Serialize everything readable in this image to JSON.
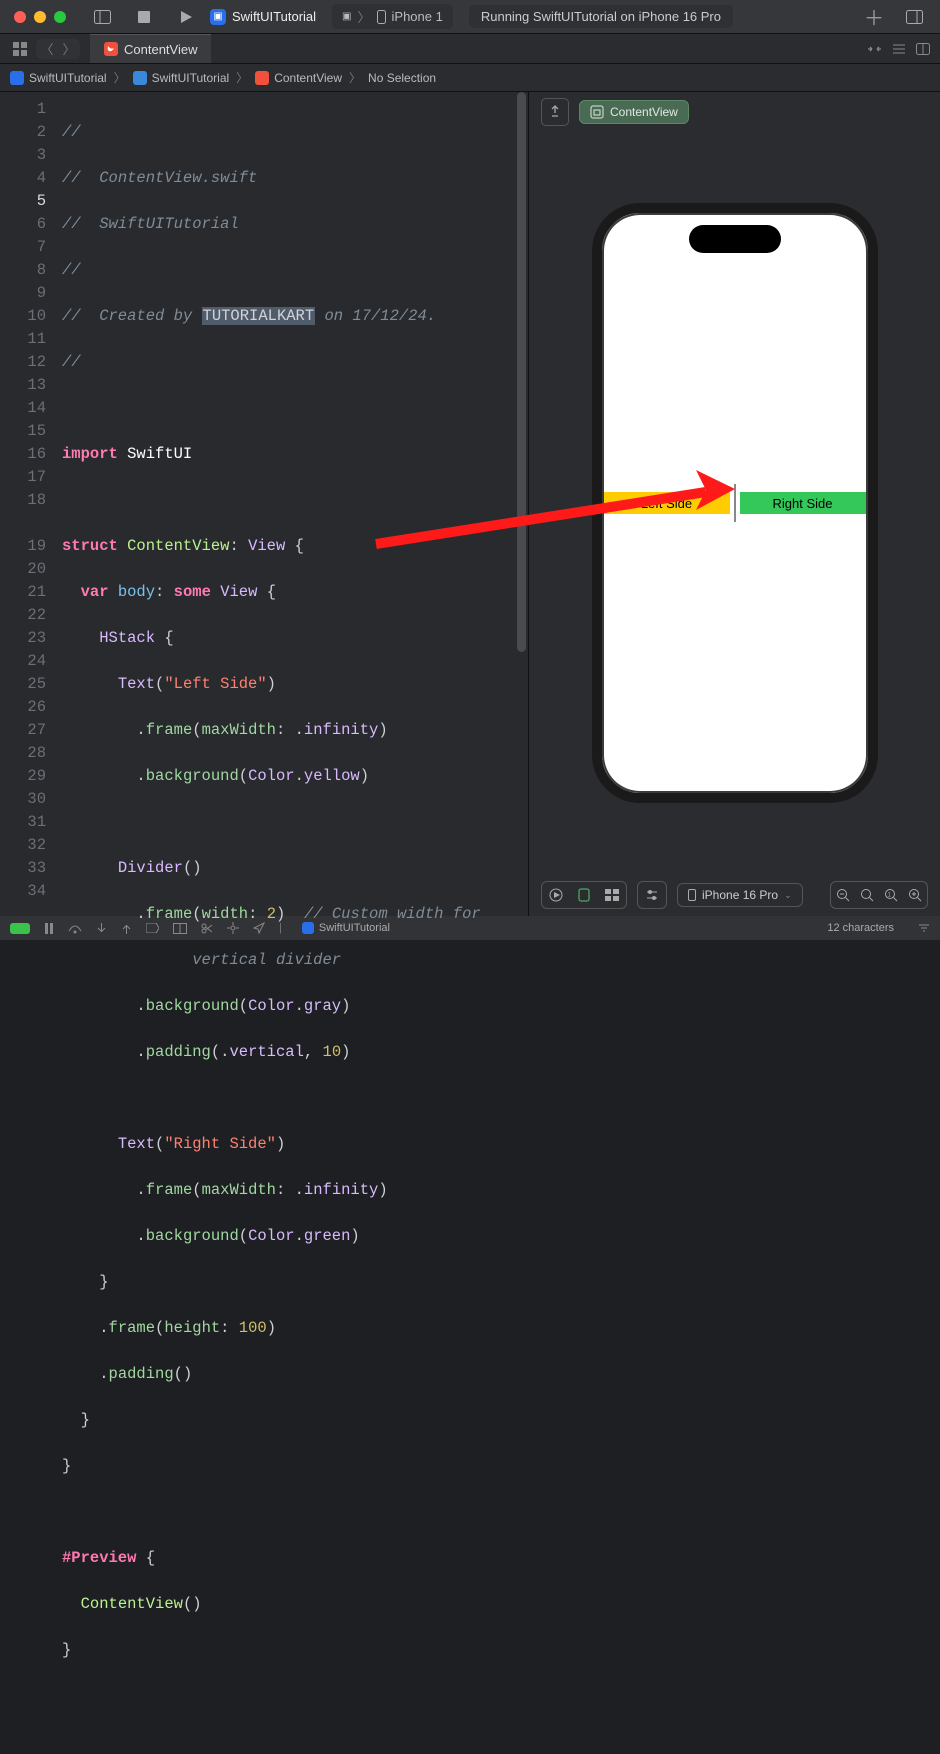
{
  "titlebar": {
    "project": "SwiftUITutorial",
    "device": "iPhone 1",
    "status": "Running SwiftUITutorial on iPhone 16 Pro"
  },
  "tab": {
    "title": "ContentView"
  },
  "breadcrumb": {
    "project": "SwiftUITutorial",
    "folder": "SwiftUITutorial",
    "file": "ContentView",
    "selection": "No Selection"
  },
  "code": {
    "author": "TUTORIALKART",
    "date": "17/12/24",
    "file_header1": "ContentView.swift",
    "file_header2": "SwiftUITutorial",
    "import_kw": "import",
    "import_mod": "SwiftUI",
    "left_text": "\"Left Side\"",
    "right_text": "\"Right Side\"",
    "divider_comment": "// Custom width for",
    "divider_comment2": "vertical divider",
    "width_val": "2",
    "pad_val": "10",
    "h_val": "100"
  },
  "preview": {
    "chip": "ContentView",
    "left": "Left Side",
    "right": "Right Side",
    "device": "iPhone 16 Pro"
  },
  "bottombar": {
    "project": "SwiftUITutorial",
    "status": "12 characters"
  }
}
